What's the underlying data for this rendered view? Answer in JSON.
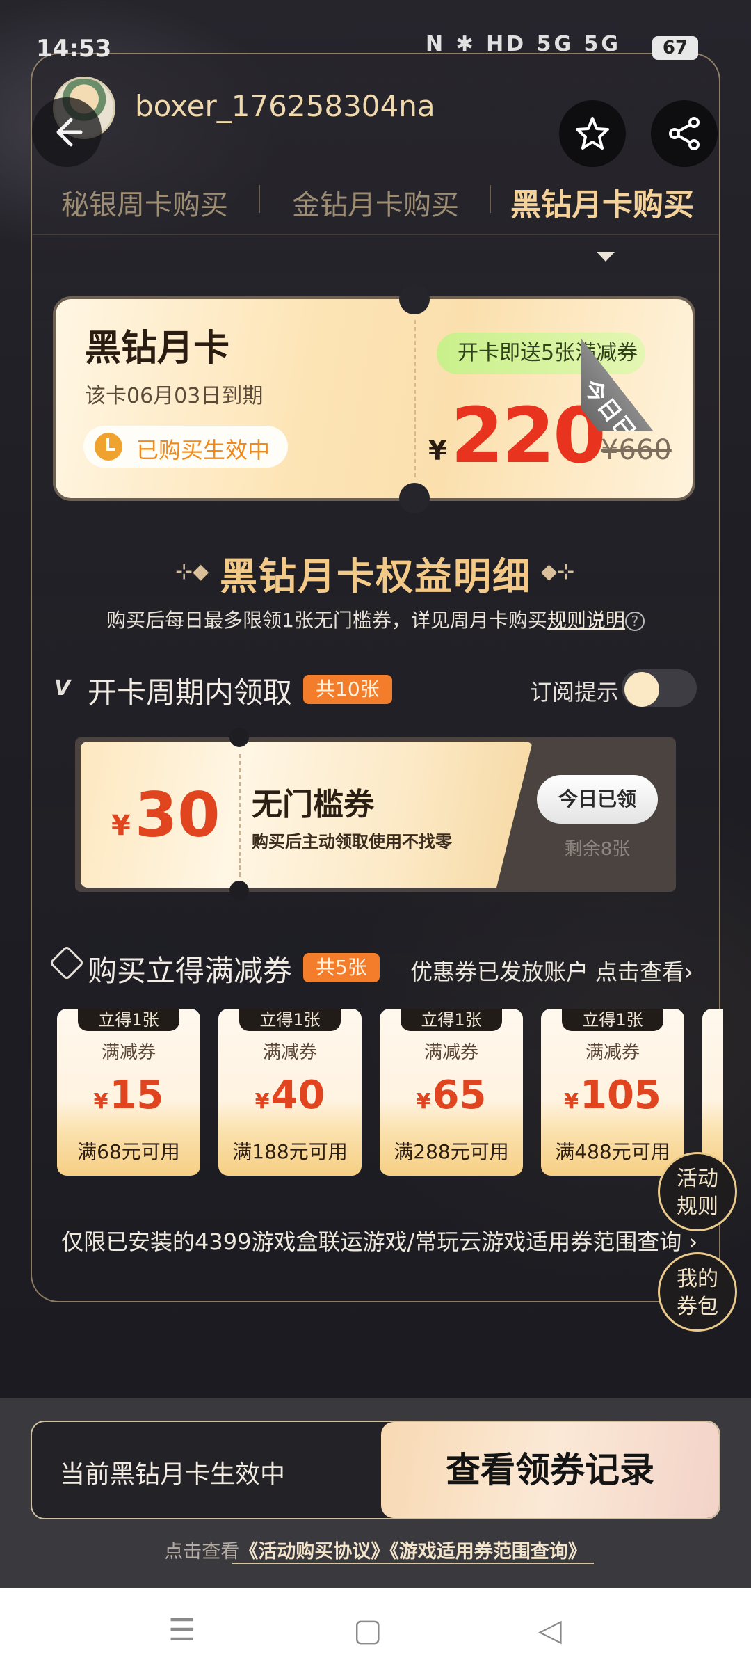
{
  "status_bar": {
    "time": "14:53",
    "icons": "N ✱ HD 5G 5G",
    "battery": "67"
  },
  "header": {
    "username": "boxer_176258304na"
  },
  "tabs": [
    {
      "label": "秘银周卡购买"
    },
    {
      "label": "金钻月卡购买"
    },
    {
      "label": "黑钻月卡购买"
    }
  ],
  "card": {
    "title": "黑钻月卡",
    "expire": "该卡06月03日到期",
    "status": "已购买生效中",
    "gift": "开卡即送5张满减券",
    "currency": "¥",
    "price": "220",
    "old_price": "¥660",
    "ribbon": "今日已领"
  },
  "benefits": {
    "ornament_left": "⊹◆",
    "title": "黑钻月卡权益明细",
    "ornament_right": "◆⊹",
    "desc_prefix": "购买后每日最多限领1张无门槛券，详见周月卡购买",
    "desc_link": "规则说明",
    "desc_icon": "?"
  },
  "collect": {
    "vip_icon": "V",
    "title": "开卡周期内领取",
    "count": "共10张",
    "subscribe_label": "订阅提示",
    "coupon": {
      "currency": "¥",
      "value": "30",
      "name": "无门槛券",
      "desc": "购买后主动领取使用不找零",
      "button": "今日已领",
      "remaining": "剩余8张"
    }
  },
  "immediate": {
    "title": "购买立得满减券",
    "count": "共5张",
    "info": "优惠券已发放账户",
    "link": "点击查看",
    "coupons": [
      {
        "top": "立得1张",
        "type": "满减券",
        "currency": "¥",
        "value": "15",
        "condition": "满68元可用"
      },
      {
        "top": "立得1张",
        "type": "满减券",
        "currency": "¥",
        "value": "40",
        "condition": "满188元可用"
      },
      {
        "top": "立得1张",
        "type": "满减券",
        "currency": "¥",
        "value": "65",
        "condition": "满288元可用"
      },
      {
        "top": "立得1张",
        "type": "满减券",
        "currency": "¥",
        "value": "105",
        "condition": "满488元可用"
      }
    ]
  },
  "floating": {
    "rules_line1": "活动",
    "rules_line2": "规则",
    "wallet_line1": "我的",
    "wallet_line2": "券包"
  },
  "scope_text": "仅限已安装的4399游戏盒联运游戏/常玩云游戏适用券范围查询",
  "chevron": "›",
  "bottom": {
    "status": "当前黑钻月卡生效中",
    "button": "查看领券记录",
    "agree_prefix": "点击查看",
    "agree_link1": "《活动购买协议》",
    "agree_link2": "《游戏适用券范围查询》"
  },
  "nav": {
    "menu": "☰",
    "home": "▢",
    "back": "◁"
  }
}
